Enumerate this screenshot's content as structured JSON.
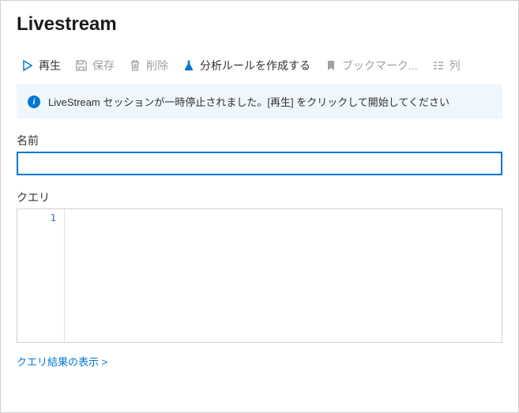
{
  "title": "Livestream",
  "toolbar": {
    "play": "再生",
    "save": "保存",
    "delete": "削除",
    "createRule": "分析ルールを作成する",
    "bookmark": "ブックマーク...",
    "columns": "列"
  },
  "info": {
    "message": "LiveStream セッションが一時停止されました。[再生] をクリックして開始してください"
  },
  "fields": {
    "nameLabel": "名前",
    "queryLabel": "クエリ",
    "nameValue": ""
  },
  "editor": {
    "line1": "1"
  },
  "resultsLink": "クエリ結果の表示  >"
}
